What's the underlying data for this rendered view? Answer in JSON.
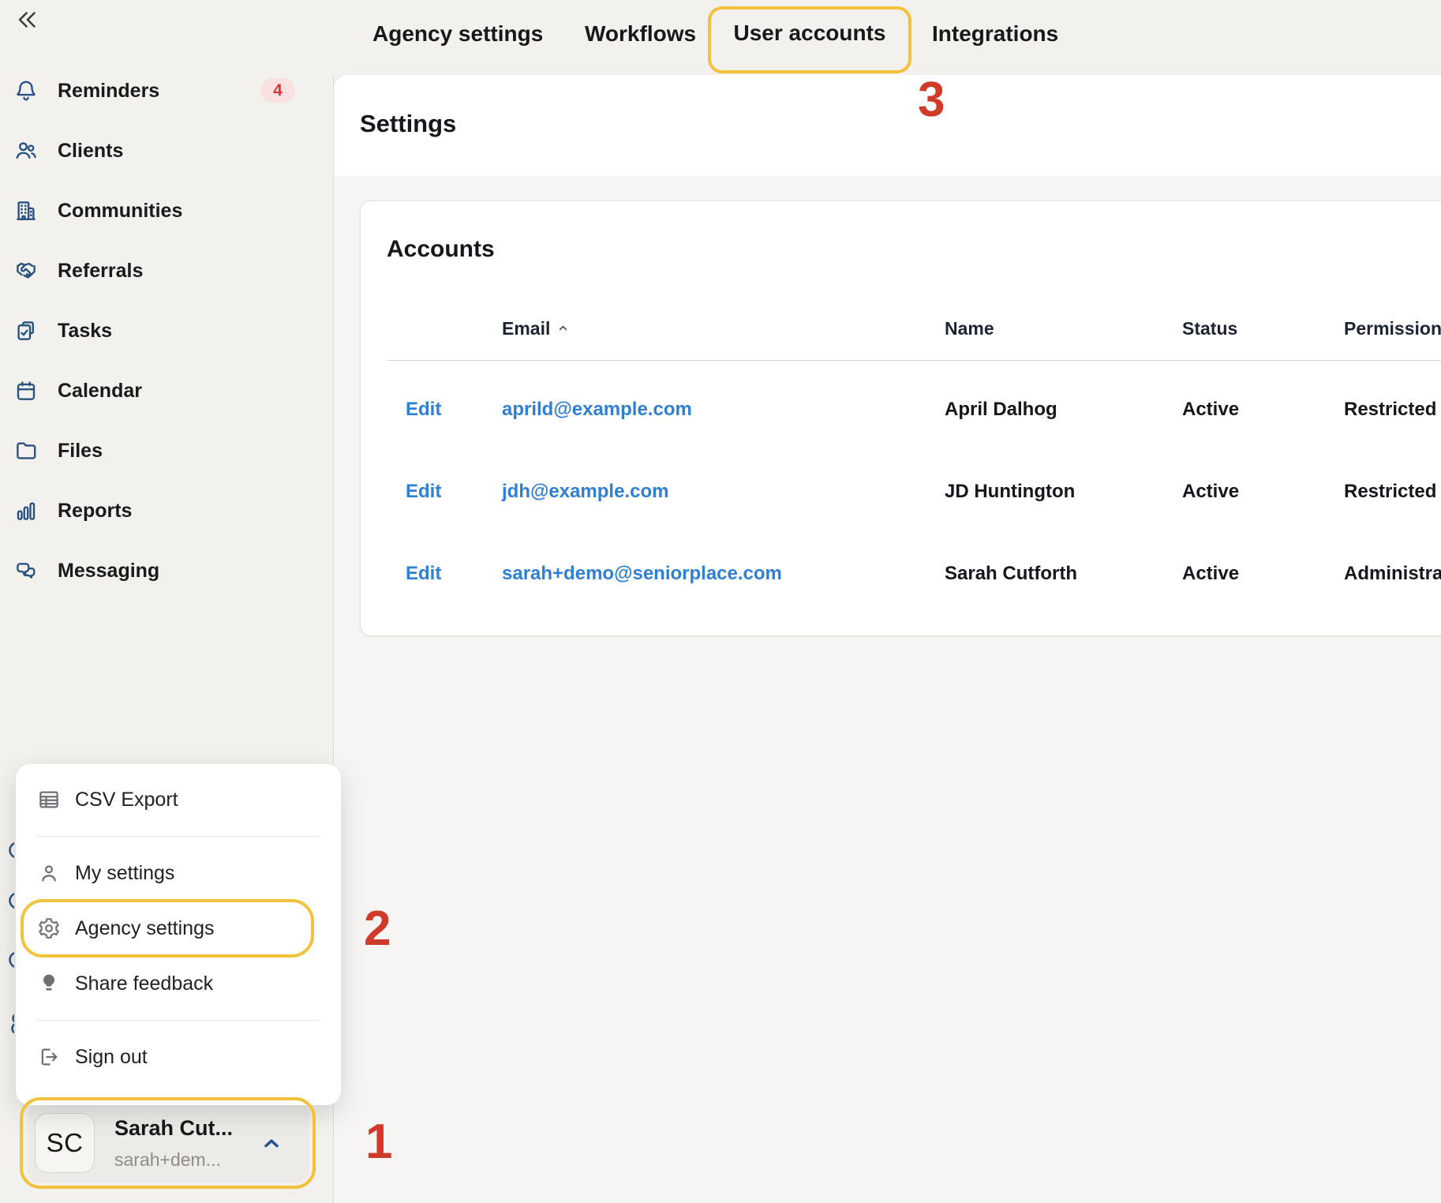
{
  "topbar": {
    "tabs": [
      {
        "label": "Agency settings",
        "active": false
      },
      {
        "label": "Workflows",
        "active": false
      },
      {
        "label": "User accounts",
        "active": true,
        "highlighted": true
      },
      {
        "label": "Integrations",
        "active": false
      }
    ]
  },
  "sidebar": {
    "items": [
      {
        "label": "Reminders",
        "icon": "bell-icon",
        "badge": "4"
      },
      {
        "label": "Clients",
        "icon": "users-icon"
      },
      {
        "label": "Communities",
        "icon": "building-icon"
      },
      {
        "label": "Referrals",
        "icon": "handshake-icon"
      },
      {
        "label": "Tasks",
        "icon": "clipboard-check-icon"
      },
      {
        "label": "Calendar",
        "icon": "calendar-icon"
      },
      {
        "label": "Files",
        "icon": "folder-icon"
      },
      {
        "label": "Reports",
        "icon": "bar-chart-icon"
      },
      {
        "label": "Messaging",
        "icon": "chat-bubbles-icon"
      }
    ]
  },
  "page": {
    "title": "Settings"
  },
  "accounts": {
    "title": "Accounts",
    "columns": {
      "email": "Email",
      "name": "Name",
      "status": "Status",
      "permissions": "Permissions"
    },
    "rows": [
      {
        "edit": "Edit",
        "email": "aprild@example.com",
        "name": "April Dalhog",
        "status": "Active",
        "permissions": "Restricted"
      },
      {
        "edit": "Edit",
        "email": "jdh@example.com",
        "name": "JD Huntington",
        "status": "Active",
        "permissions": "Restricted"
      },
      {
        "edit": "Edit",
        "email": "sarah+demo@seniorplace.com",
        "name": "Sarah Cutforth",
        "status": "Active",
        "permissions": "Administrator"
      }
    ]
  },
  "user_menu": {
    "items": [
      {
        "label": "CSV Export",
        "icon": "table-icon"
      },
      {
        "label": "My settings",
        "icon": "person-icon"
      },
      {
        "label": "Agency settings",
        "icon": "gear-icon",
        "highlighted": true
      },
      {
        "label": "Share feedback",
        "icon": "lightbulb-icon"
      },
      {
        "label": "Sign out",
        "icon": "sign-out-icon"
      }
    ]
  },
  "user_card": {
    "initials": "SC",
    "name": "Sarah Cut...",
    "email": "sarah+dem..."
  },
  "annotations": {
    "step1": "1",
    "step2": "2",
    "step3": "3"
  },
  "colors": {
    "accent_yellow": "#f2c23c",
    "annotation_red": "#cf3b28",
    "link_blue": "#2f7fd3",
    "sidebar_icon_navy": "#2a5280",
    "badge_red_text": "#df3333",
    "badge_red_bg": "#f9e1e1",
    "app_background": "#f2f1ee",
    "content_background": "#f6f5f3"
  }
}
